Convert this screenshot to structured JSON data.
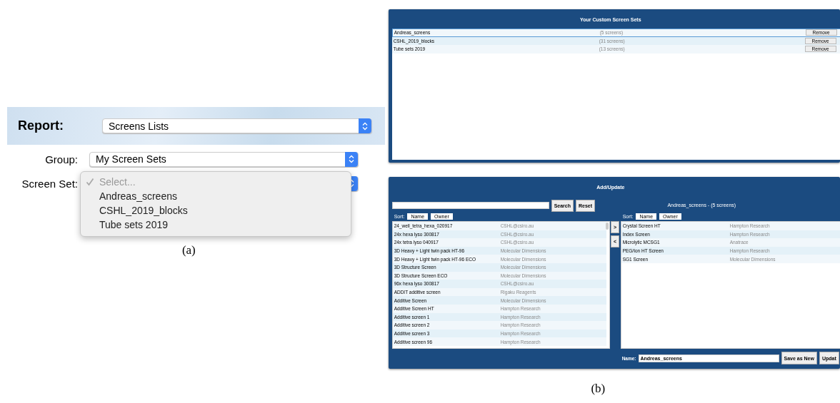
{
  "panel_a": {
    "caption": "(a)",
    "report": {
      "label": "Report:",
      "value": "Screens Lists"
    },
    "group": {
      "label": "Group:",
      "value": "My Screen Sets"
    },
    "screen_set": {
      "label": "Screen Set:",
      "menu": [
        {
          "label": "Select...",
          "checked": true,
          "disabled": true
        },
        {
          "label": "Andreas_screens",
          "checked": false,
          "disabled": false
        },
        {
          "label": "CSHL_2019_blocks",
          "checked": false,
          "disabled": false
        },
        {
          "label": "Tube sets 2019",
          "checked": false,
          "disabled": false
        }
      ]
    }
  },
  "panel_b": {
    "caption": "(b)",
    "custom_sets": {
      "title": "Your Custom Screen Sets",
      "rows": [
        {
          "name": "Andreas_screens",
          "count": "(5 screens)",
          "button": "Remove",
          "selected": true
        },
        {
          "name": "CSHL_2019_blocks",
          "count": "(31 screens)",
          "button": "Remove",
          "selected": false
        },
        {
          "name": "Tube sets 2019",
          "count": "(13 screens)",
          "button": "Remove",
          "selected": false
        }
      ]
    },
    "add_update": {
      "title": "Add/Update",
      "search_button": "Search",
      "reset_button": "Reset",
      "left_sort": {
        "label": "Sort:",
        "buttons": [
          "Name",
          "Owner"
        ]
      },
      "right_sort": {
        "label": "Sort:",
        "buttons": [
          "Name",
          "Owner"
        ]
      },
      "available": [
        {
          "name": "24_well_tetra_hexa_020917",
          "owner": "CSHL@csiro.au"
        },
        {
          "name": "24x hexa lyso 300817",
          "owner": "CSHL@csiro.au"
        },
        {
          "name": "24x tetra lyso 040917",
          "owner": "CSHL@csiro.au"
        },
        {
          "name": "3D Heavy + Light twin pack HT-96",
          "owner": "Molecular Dimensions"
        },
        {
          "name": "3D Heavy + Light twin pack HT-96 ECO",
          "owner": "Molecular Dimensions"
        },
        {
          "name": "3D Structure Screen",
          "owner": "Molecular Dimensions"
        },
        {
          "name": "3D Structure Screen ECO",
          "owner": "Molecular Dimensions"
        },
        {
          "name": "96x hexa lyso 300817",
          "owner": "CSHL@csiro.au"
        },
        {
          "name": "ADDIT additive screen",
          "owner": "Rigaku Reagents"
        },
        {
          "name": "Additive Screen",
          "owner": "Molecular Dimensions"
        },
        {
          "name": "Additive Screen HT",
          "owner": "Hampton Research"
        },
        {
          "name": "Additive screen 1",
          "owner": "Hampton Research"
        },
        {
          "name": "Additive screen 2",
          "owner": "Hampton Research"
        },
        {
          "name": "Additive screen 3",
          "owner": "Hampton Research"
        },
        {
          "name": "Additive screen 96",
          "owner": "Hampton Research"
        }
      ],
      "move_buttons": [
        ">",
        "<"
      ],
      "set_title": "Andreas_screens - (5 screens)",
      "chosen": [
        {
          "name": "Crystal Screen HT",
          "owner": "Hampton Research"
        },
        {
          "name": "Index Screen",
          "owner": "Hampton Research"
        },
        {
          "name": "Microlytic MCSG1",
          "owner": "Anatrace"
        },
        {
          "name": "PEG/Ion HT Screen",
          "owner": "Hampton Research"
        },
        {
          "name": "SG1 Screen",
          "owner": "Molecular Dimensions"
        }
      ],
      "name_label": "Name:",
      "name_value": "Andreas_screens",
      "save_button": "Save as New",
      "update_button": "Updat"
    }
  }
}
